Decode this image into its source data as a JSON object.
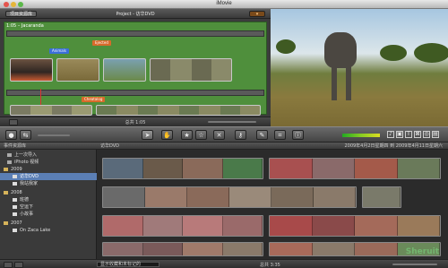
{
  "window": {
    "title": "iMovie"
  },
  "project": {
    "library_button": "项目资源库",
    "title": "Project - 访华DVD",
    "clip_label": "1:05 – Jacaranda",
    "titles": [
      "Ejected",
      "Animals",
      "Cheatalog"
    ],
    "duration": "总共 1:05"
  },
  "sidebar": {
    "header": "事件资源库",
    "items": [
      {
        "label": "上一次导入",
        "level": 1,
        "kind": "folder",
        "selected": false
      },
      {
        "label": "iPhoto 视频",
        "level": 1,
        "kind": "folder",
        "selected": false
      },
      {
        "label": "2009",
        "level": 0,
        "kind": "year",
        "selected": false
      },
      {
        "label": "访华DVD",
        "level": 2,
        "kind": "event",
        "selected": true
      },
      {
        "label": "我站我家",
        "level": 2,
        "kind": "event",
        "selected": false
      },
      {
        "label": "2008",
        "level": 0,
        "kind": "year",
        "selected": false
      },
      {
        "label": "班德",
        "level": 2,
        "kind": "event",
        "selected": false
      },
      {
        "label": "空运下",
        "level": 2,
        "kind": "event",
        "selected": false
      },
      {
        "label": "小故事",
        "level": 2,
        "kind": "event",
        "selected": false
      },
      {
        "label": "2007",
        "level": 0,
        "kind": "year",
        "selected": false
      },
      {
        "label": "On Zaca Lake",
        "level": 2,
        "kind": "event",
        "selected": false
      }
    ]
  },
  "browser": {
    "event_name": "访华DVD",
    "date_range": "2009年4月2日星期四 到 2009年4月11日星期六",
    "show_select": "显示收藏和未标记的",
    "total": "总共 3:35"
  },
  "toolbar": {
    "tools": [
      {
        "name": "arrow-tool",
        "glyph": "➤",
        "active": true
      },
      {
        "name": "hand-tool",
        "glyph": "✋",
        "active": false
      },
      {
        "name": "favorite-tool",
        "glyph": "★",
        "active": false
      },
      {
        "name": "unmark-tool",
        "glyph": "☆",
        "active": false
      },
      {
        "name": "reject-tool",
        "glyph": "✕",
        "active": false
      },
      {
        "name": "keyword-tool",
        "glyph": "⚷",
        "active": false
      },
      {
        "name": "dropper-tool",
        "glyph": "✎",
        "active": false
      },
      {
        "name": "crop-tool",
        "glyph": "⌗",
        "active": false
      },
      {
        "name": "info-tool",
        "glyph": "ⓘ",
        "active": false
      }
    ]
  },
  "watermark": "Sheruit"
}
